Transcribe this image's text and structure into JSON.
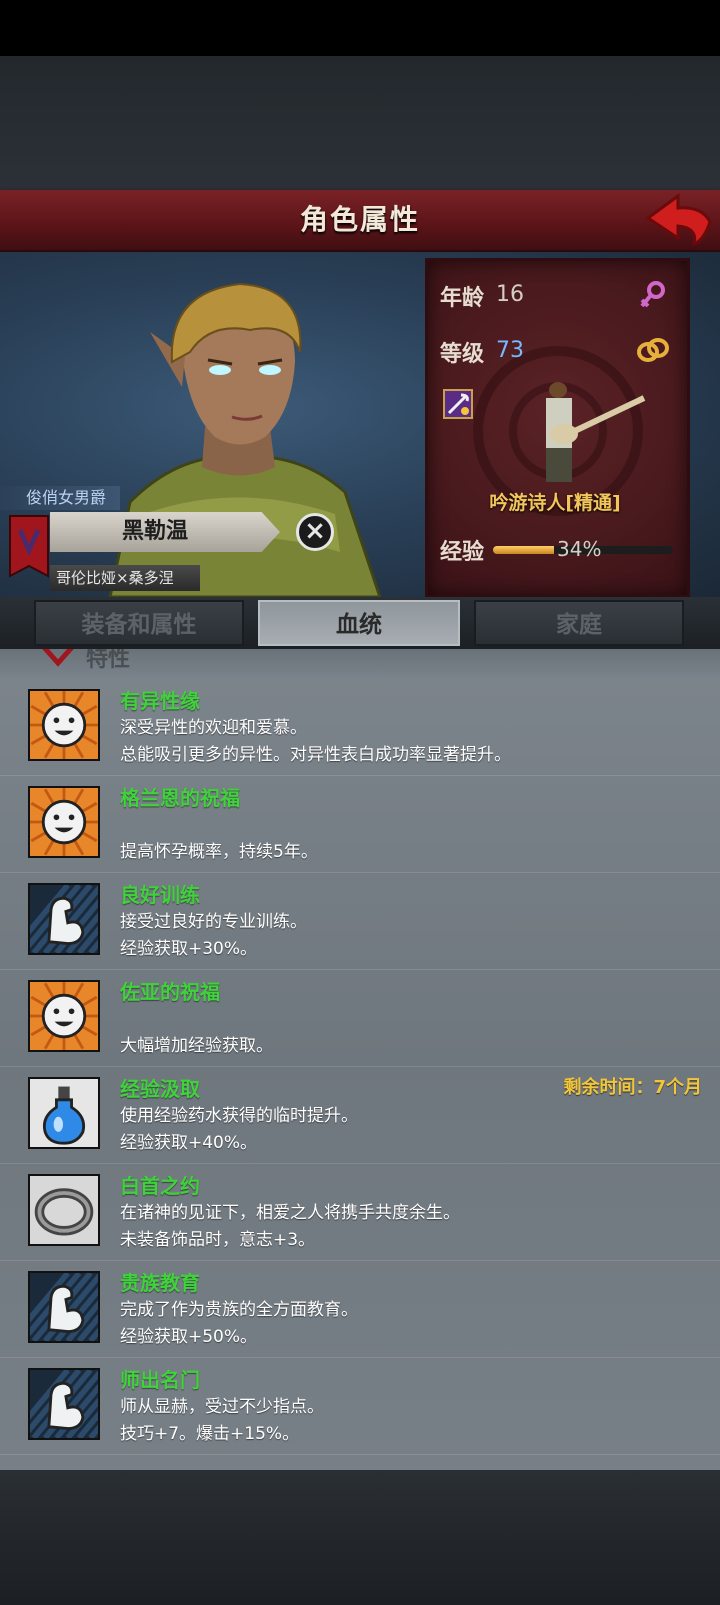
{
  "header": {
    "title": "角色属性"
  },
  "character": {
    "title": "俊俏女男爵",
    "name": "黑勒温",
    "origin": "哥伦比娅×桑多涅"
  },
  "stats": {
    "age_label": "年龄",
    "age": "16",
    "level_label": "等级",
    "level": "73",
    "class_name": "吟游诗人[精通]",
    "exp_label": "经验",
    "exp_percent": "34%",
    "exp_fraction": 0.34,
    "gender_icon": "female-symbol-icon",
    "marriage_icon": "rings-icon"
  },
  "tabs": [
    {
      "label": "装备和属性",
      "active": false
    },
    {
      "label": "血统",
      "active": true
    },
    {
      "label": "家庭",
      "active": false
    }
  ],
  "section": {
    "label": "特性"
  },
  "traits": [
    {
      "name": "有异性缘",
      "icon": "smiley-sun-icon",
      "lines": [
        "深受异性的欢迎和爱慕。",
        "总能吸引更多的异性。对异性表白成功率显著提升。"
      ],
      "right": ""
    },
    {
      "name": "格兰恩的祝福",
      "icon": "smiley-sun-icon",
      "lines": [
        "",
        "提高怀孕概率，持续5年。"
      ],
      "right": ""
    },
    {
      "name": "良好训练",
      "icon": "flexed-arm-icon",
      "lines": [
        "接受过良好的专业训练。",
        "经验获取+30%。"
      ],
      "right": ""
    },
    {
      "name": "佐亚的祝福",
      "icon": "smiley-sun-icon",
      "lines": [
        "",
        "大幅增加经验获取。"
      ],
      "right": ""
    },
    {
      "name": "经验汲取",
      "icon": "potion-icon",
      "lines": [
        "使用经验药水获得的临时提升。",
        "经验获取+40%。"
      ],
      "right": "剩余时间：7个月"
    },
    {
      "name": "白首之约",
      "icon": "ring-icon",
      "lines": [
        "在诸神的见证下，相爱之人将携手共度余生。",
        "未装备饰品时，意志+3。"
      ],
      "right": ""
    },
    {
      "name": "贵族教育",
      "icon": "flexed-arm-icon",
      "lines": [
        "完成了作为贵族的全方面教育。",
        "经验获取+50%。"
      ],
      "right": ""
    },
    {
      "name": "师出名门",
      "icon": "flexed-arm-icon",
      "lines": [
        "师从显赫，受过不少指点。",
        "技巧+7。爆击+15%。"
      ],
      "right": ""
    }
  ]
}
